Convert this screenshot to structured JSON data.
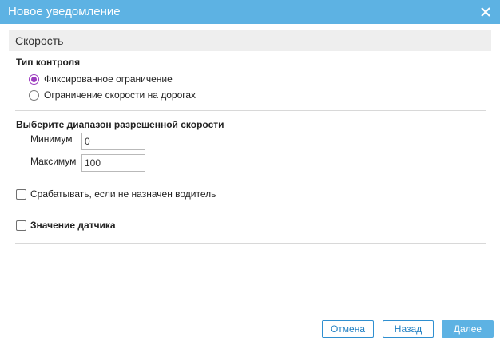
{
  "dialog": {
    "title": "Новое уведомление",
    "close_icon": "close-icon"
  },
  "section": {
    "title": "Скорость"
  },
  "control_type": {
    "label": "Тип контроля",
    "options": [
      {
        "label": "Фиксированное ограничение",
        "selected": true
      },
      {
        "label": "Ограничение скорости на дорогах",
        "selected": false
      }
    ]
  },
  "speed_range": {
    "label": "Выберите диапазон разрешенной скорости",
    "min_label": "Минимум",
    "min_value": "0",
    "max_label": "Максимум",
    "max_value": "100"
  },
  "driver_check": {
    "label": "Срабатывать, если не назначен водитель",
    "checked": false
  },
  "sensor_check": {
    "label": "Значение датчика",
    "checked": false
  },
  "buttons": {
    "cancel": "Отмена",
    "back": "Назад",
    "next": "Далее"
  },
  "colors": {
    "title_bar": "#5db2e3",
    "radio_accent": "#9b3bbf",
    "button_border": "#2f8fd0"
  }
}
